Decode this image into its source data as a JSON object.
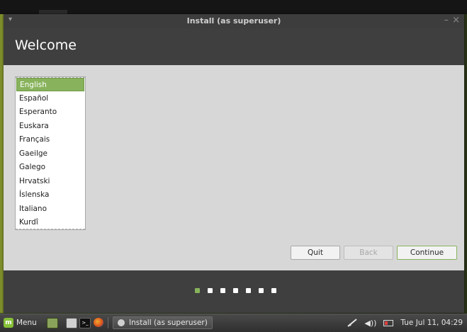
{
  "window": {
    "title": "Install (as superuser)",
    "menu_glyph": "▾",
    "minimize_glyph": "–",
    "close_glyph": "×"
  },
  "header": {
    "title": "Welcome"
  },
  "languages": {
    "selected": "English",
    "items": [
      "English",
      "Español",
      "Esperanto",
      "Euskara",
      "Français",
      "Gaeilge",
      "Galego",
      "Hrvatski",
      "Íslenska",
      "Italiano",
      "Kurdî"
    ]
  },
  "buttons": {
    "quit": "Quit",
    "back": "Back",
    "continue": "Continue"
  },
  "progress": {
    "total_steps": 7,
    "current_step": 1
  },
  "taskbar": {
    "menu_label": "Menu",
    "mint_logo": "m",
    "terminal_glyph": ">_",
    "window_button": "Install (as superuser)",
    "clock": "Tue Jul 11, 04:29",
    "volume_glyph": "◀))"
  },
  "colors": {
    "accent": "#88b35c",
    "header_bg": "#3f3f3f",
    "content_bg": "#d7d7d7"
  }
}
